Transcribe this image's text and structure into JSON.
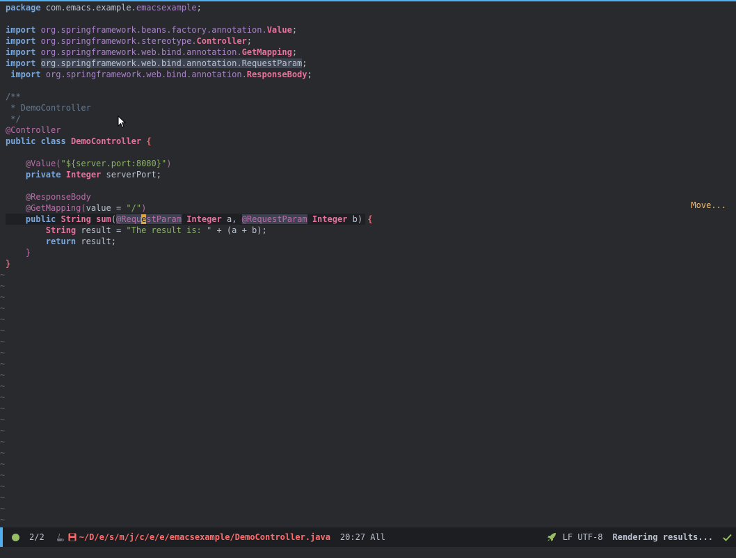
{
  "code": {
    "line1": {
      "kw": "package",
      "plain": " com.emacs.example.",
      "pkg": "emacsexample",
      "end": ";"
    },
    "imports": [
      {
        "kw": "import",
        "pkg": " org.springframework.beans.factory.annotation.",
        "ty": "Value",
        "end": ";"
      },
      {
        "kw": "import",
        "pkg": " org.springframework.stereotype.",
        "ty": "Controller",
        "end": ";"
      },
      {
        "kw": "import",
        "pkg": " org.springframework.web.bind.annotation.",
        "ty": "GetMapping",
        "end": ";"
      },
      {
        "kw": "import",
        "hl": "org.springframework.web.bind.annotation.RequestParam",
        "end": ";"
      },
      {
        "kw": " import",
        "pkg": " org.springframework.web.bind.annotation.",
        "ty": "ResponseBody",
        "end": ";"
      }
    ],
    "comment": [
      "/**",
      " * DemoController",
      " */"
    ],
    "controller_ann": "@Controller",
    "class_decl": {
      "kw": "public class",
      "name": "DemoController",
      "brace": "{"
    },
    "value_ann": {
      "ann": "@Value(",
      "str": "\"${server.port:8080}\"",
      "close": ")"
    },
    "field": {
      "kw": "private",
      "ty": "Integer",
      "name": " serverPort;"
    },
    "resp_ann": "@ResponseBody",
    "getmap": {
      "ann": "@GetMapping(",
      "plain": "value = ",
      "str": "\"/\"",
      "close": ")"
    },
    "method": {
      "kw": "public",
      "ty1": "String",
      "name": "sum",
      "open": "(",
      "p1a": "@Requ",
      "p1cur": "e",
      "p1b": "stParam",
      "ty2": "Integer",
      "a": " a, ",
      "p2": "@RequestParam",
      "ty3": "Integer",
      "b": " b",
      "close": ")",
      "brace": "{"
    },
    "body1": {
      "ty": "String",
      "plain": " result = ",
      "str": "\"The result is: \"",
      "rest": " + (a + b);"
    },
    "body2": {
      "kw": "return",
      "plain": " result;"
    },
    "inner_close": "}",
    "outer_close": "}"
  },
  "hint": "Move...",
  "tilde": "~",
  "modeline": {
    "count": "2/2",
    "path": "~/D/e/s/m/j/c/e/e/emacsexample/DemoController.java",
    "position": "20:27 All",
    "encoding": "LF UTF-8",
    "status": "Rendering results..."
  }
}
